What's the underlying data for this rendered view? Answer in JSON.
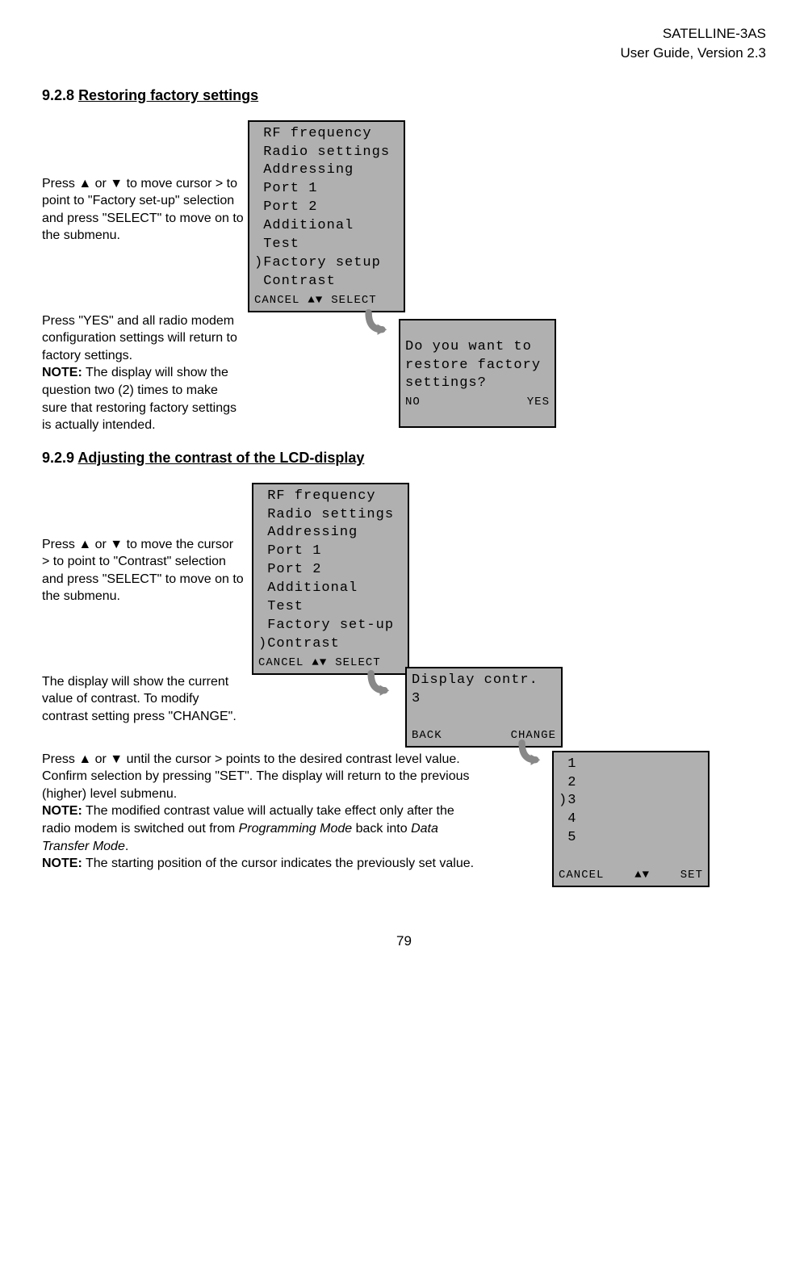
{
  "header": {
    "product": "SATELLINE-3AS",
    "guide": "User Guide, Version 2.3"
  },
  "section1": {
    "number": "9.2.8",
    "title": "Restoring factory settings",
    "instruction1": "Press ▲ or ▼ to move cursor > to point to \"Factory set-up\" selection and press \"SELECT\" to move on to the submenu.",
    "lcd1_body": " RF frequency\n Radio settings\n Addressing\n Port 1\n Port 2\n Additional\n Test\n)Factory setup\n Contrast",
    "lcd1_footer_left": "CANCEL",
    "lcd1_footer_mid": "▲▼",
    "lcd1_footer_right": "SELECT",
    "instruction2_part1": "Press \"YES\" and all radio modem configuration settings will return to factory settings.",
    "instruction2_note_label": "NOTE:",
    "instruction2_part2": " The display will show the question two (2) times to make sure that restoring factory settings is actually intended.",
    "lcd2_body": "Do you want to\nrestore factory\nsettings?",
    "lcd2_footer_left": "NO",
    "lcd2_footer_right": "YES"
  },
  "section2": {
    "number": "9.2.9",
    "title": "Adjusting the contrast of the LCD-display",
    "instruction1": "Press ▲ or ▼ to move the cursor > to point to \"Contrast\" selection and press \"SELECT\" to move on to the submenu.",
    "lcd1_body": " RF frequency\n Radio settings\n Addressing\n Port 1\n Port 2\n Additional\n Test\n Factory set-up\n)Contrast",
    "lcd1_footer_left": "CANCEL",
    "lcd1_footer_mid": "▲▼",
    "lcd1_footer_right": "SELECT",
    "instruction2": "The display will show the current value of contrast. To modify contrast setting press \"CHANGE\".",
    "lcd2_body": "Display contr.\n3\n ",
    "lcd2_footer_left": "BACK",
    "lcd2_footer_right": "CHANGE",
    "instruction3_part1": "Press ▲ or ▼  until the cursor > points to the desired contrast level value. Confirm selection by pressing \"SET\". The display will return to the previous (higher) level submenu.",
    "instruction3_note1_label": "NOTE:",
    "instruction3_part2a": " The modified contrast value will actually take effect only after the radio modem is switched out from ",
    "instruction3_italic1": "Programming Mode",
    "instruction3_part2b": " back into ",
    "instruction3_italic2": "Data Transfer Mode",
    "instruction3_part2c": ".",
    "instruction3_note2_label": "NOTE:",
    "instruction3_part3": " The starting position of the cursor indicates the previously set value.",
    "lcd3_body": " 1\n 2\n)3\n 4\n 5\n ",
    "lcd3_footer_left": "CANCEL",
    "lcd3_footer_mid": "▲▼",
    "lcd3_footer_right": "SET"
  },
  "page_number": "79"
}
